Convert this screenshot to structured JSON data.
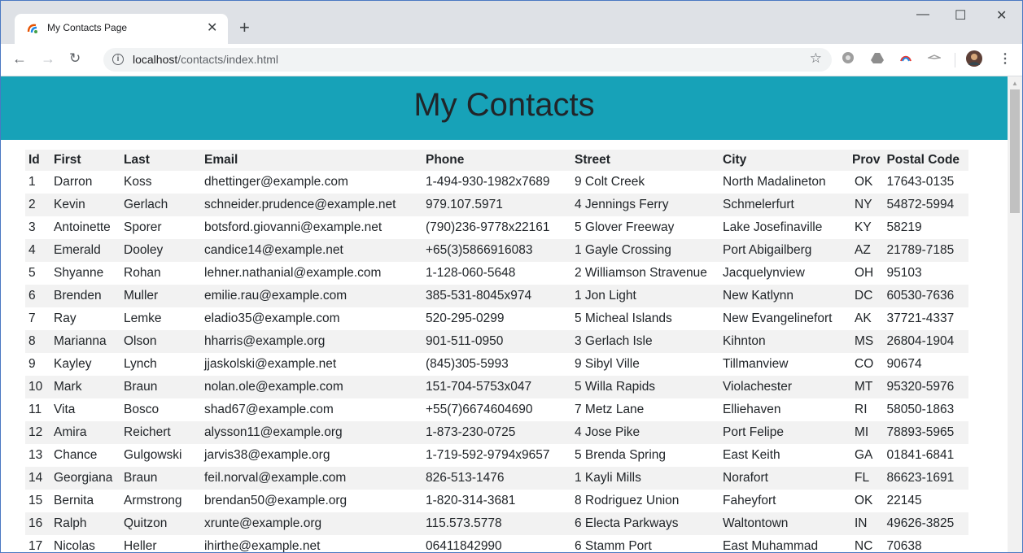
{
  "browser": {
    "tab_title": "My Contacts Page",
    "url_host": "localhost",
    "url_path": "/contacts/index.html"
  },
  "page": {
    "heading": "My Contacts",
    "banner_color": "#17a2b8"
  },
  "table": {
    "headers": [
      "Id",
      "First",
      "Last",
      "Email",
      "Phone",
      "Street",
      "City",
      "Prov",
      "Postal Code"
    ],
    "rows": [
      [
        "1",
        "Darron",
        "Koss",
        "dhettinger@example.com",
        "1-494-930-1982x7689",
        "9 Colt Creek",
        "North Madalineton",
        "OK",
        "17643-0135"
      ],
      [
        "2",
        "Kevin",
        "Gerlach",
        "schneider.prudence@example.net",
        "979.107.5971",
        "4 Jennings Ferry",
        "Schmelerfurt",
        "NY",
        "54872-5994"
      ],
      [
        "3",
        "Antoinette",
        "Sporer",
        "botsford.giovanni@example.net",
        "(790)236-9778x22161",
        "5 Glover Freeway",
        "Lake Josefinaville",
        "KY",
        "58219"
      ],
      [
        "4",
        "Emerald",
        "Dooley",
        "candice14@example.net",
        "+65(3)5866916083",
        "1 Gayle Crossing",
        "Port Abigailberg",
        "AZ",
        "21789-7185"
      ],
      [
        "5",
        "Shyanne",
        "Rohan",
        "lehner.nathanial@example.com",
        "1-128-060-5648",
        "2 Williamson Stravenue",
        "Jacquelynview",
        "OH",
        "95103"
      ],
      [
        "6",
        "Brenden",
        "Muller",
        "emilie.rau@example.com",
        "385-531-8045x974",
        "1 Jon Light",
        "New Katlynn",
        "DC",
        "60530-7636"
      ],
      [
        "7",
        "Ray",
        "Lemke",
        "eladio35@example.com",
        "520-295-0299",
        "5 Micheal Islands",
        "New Evangelinefort",
        "AK",
        "37721-4337"
      ],
      [
        "8",
        "Marianna",
        "Olson",
        "hharris@example.org",
        "901-511-0950",
        "3 Gerlach Isle",
        "Kihnton",
        "MS",
        "26804-1904"
      ],
      [
        "9",
        "Kayley",
        "Lynch",
        "jjaskolski@example.net",
        "(845)305-5993",
        "9 Sibyl Ville",
        "Tillmanview",
        "CO",
        "90674"
      ],
      [
        "10",
        "Mark",
        "Braun",
        "nolan.ole@example.com",
        "151-704-5753x047",
        "5 Willa Rapids",
        "Violachester",
        "MT",
        "95320-5976"
      ],
      [
        "11",
        "Vita",
        "Bosco",
        "shad67@example.com",
        "+55(7)6674604690",
        "7 Metz Lane",
        "Elliehaven",
        "RI",
        "58050-1863"
      ],
      [
        "12",
        "Amira",
        "Reichert",
        "alysson11@example.org",
        "1-873-230-0725",
        "4 Jose Pike",
        "Port Felipe",
        "MI",
        "78893-5965"
      ],
      [
        "13",
        "Chance",
        "Gulgowski",
        "jarvis38@example.org",
        "1-719-592-9794x9657",
        "5 Brenda Spring",
        "East Keith",
        "GA",
        "01841-6841"
      ],
      [
        "14",
        "Georgiana",
        "Braun",
        "feil.norval@example.com",
        "826-513-1476",
        "1 Kayli Mills",
        "Norafort",
        "FL",
        "86623-1691"
      ],
      [
        "15",
        "Bernita",
        "Armstrong",
        "brendan50@example.org",
        "1-820-314-3681",
        "8 Rodriguez Union",
        "Faheyfort",
        "OK",
        "22145"
      ],
      [
        "16",
        "Ralph",
        "Quitzon",
        "xrunte@example.org",
        "115.573.5778",
        "6 Electa Parkways",
        "Waltontown",
        "IN",
        "49626-3825"
      ],
      [
        "17",
        "Nicolas",
        "Heller",
        "ihirthe@example.net",
        "06411842990",
        "6 Stamm Port",
        "East Muhammad",
        "NC",
        "70638"
      ]
    ]
  }
}
